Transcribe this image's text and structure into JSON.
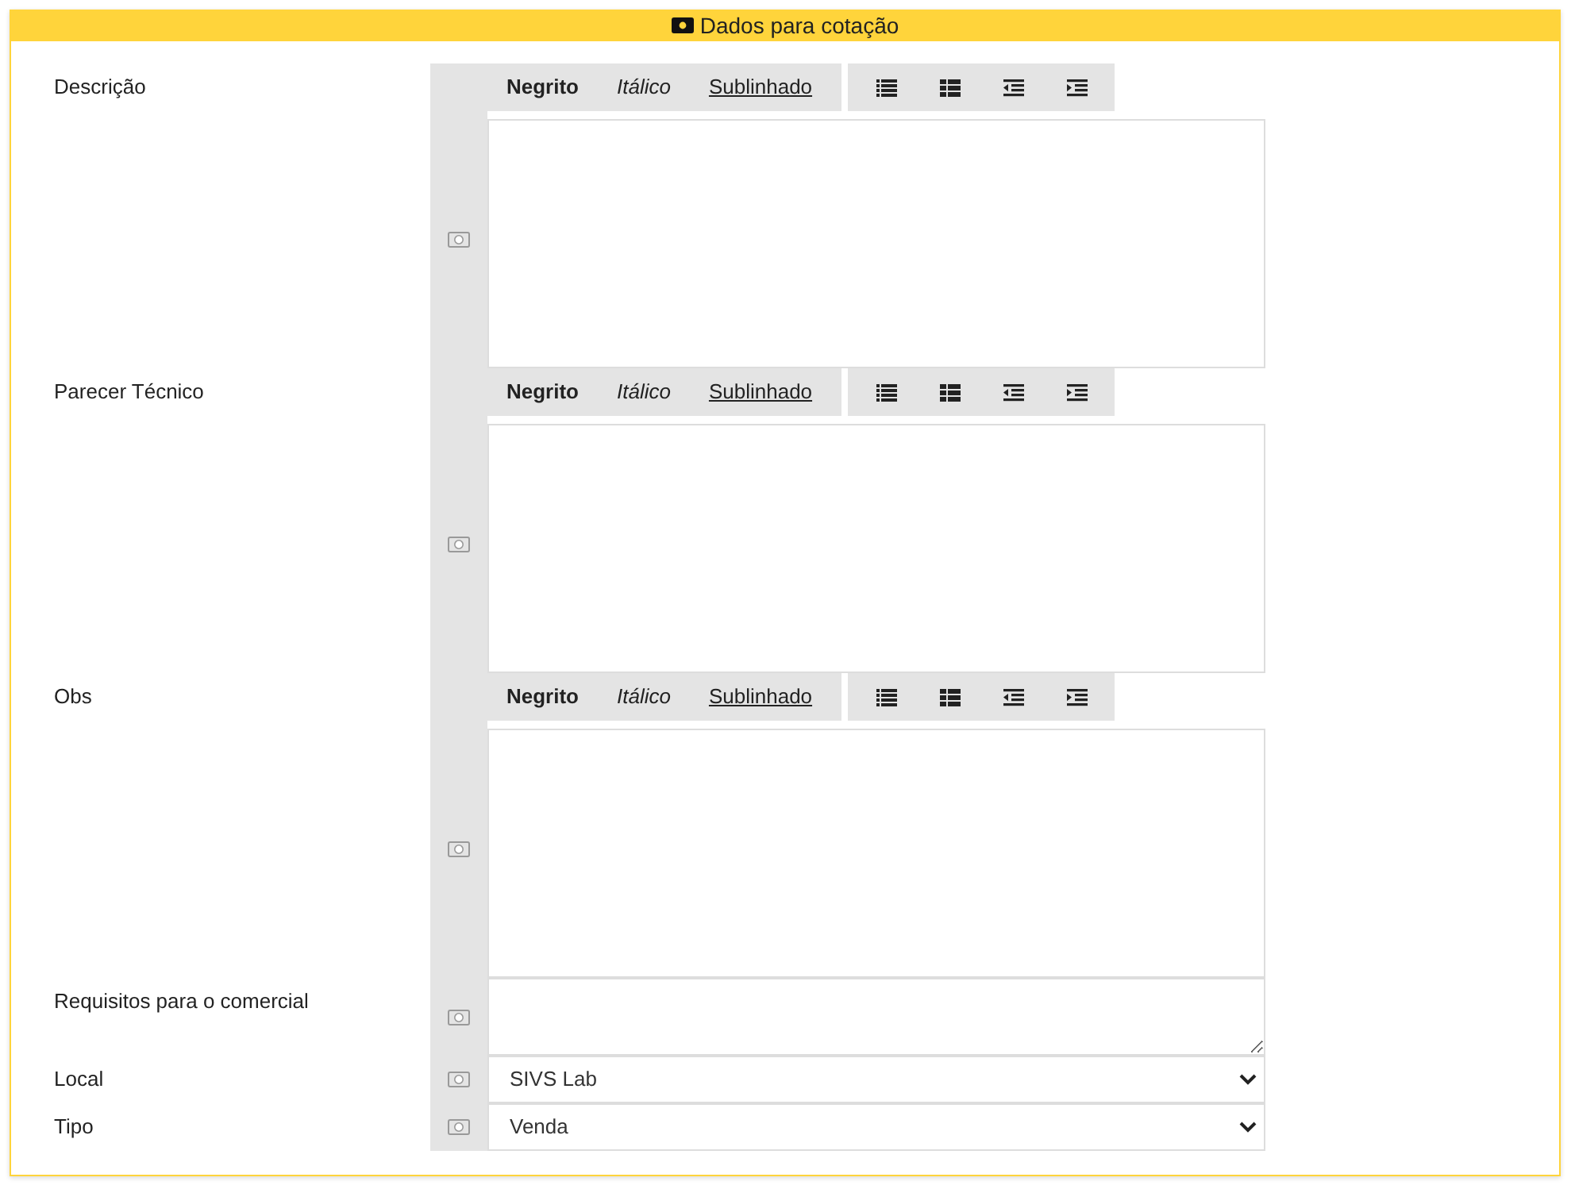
{
  "panel": {
    "title": "Dados para cotação"
  },
  "fields": [
    {
      "kind": "editor",
      "label": "Descrição",
      "toolbar": [
        {
          "kind": "bold",
          "label": "Negrito"
        },
        {
          "kind": "italic",
          "label": "Itálico"
        },
        {
          "kind": "underline",
          "label": "Sublinhado"
        }
      ]
    },
    {
      "kind": "editor",
      "label": "Parecer Técnico",
      "toolbar": [
        {
          "kind": "bold",
          "label": "Negrito"
        },
        {
          "kind": "italic",
          "label": "Itálico"
        },
        {
          "kind": "underline",
          "label": "Sublinhado"
        }
      ]
    },
    {
      "kind": "editor",
      "label": "Obs",
      "toolbar": [
        {
          "kind": "bold",
          "label": "Negrito"
        },
        {
          "kind": "italic",
          "label": "Itálico"
        },
        {
          "kind": "underline",
          "label": "Sublinhado"
        }
      ]
    },
    {
      "kind": "textarea",
      "label": "Requisitos para o comercial"
    },
    {
      "kind": "select",
      "label": "Local",
      "value": "SIVS Lab"
    },
    {
      "kind": "select",
      "label": "Tipo",
      "value": "Venda"
    }
  ]
}
